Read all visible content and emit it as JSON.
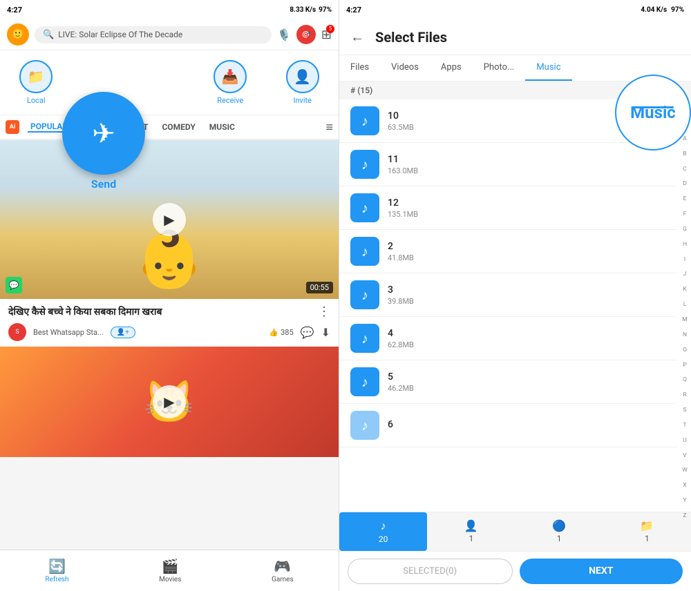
{
  "left": {
    "statusBar": {
      "time": "4:27",
      "speed": "8.33 K/s",
      "battery": "97%"
    },
    "searchBar": {
      "placeholder": "LIVE: Solar Eclipse Of The Decade"
    },
    "actions": [
      {
        "id": "local",
        "label": "Local",
        "icon": "📁"
      },
      {
        "id": "send",
        "label": "Send",
        "icon": "➤"
      },
      {
        "id": "receive",
        "label": "Receive",
        "icon": "📥"
      },
      {
        "id": "invite",
        "label": "Invite",
        "icon": "👤+"
      }
    ],
    "categories": [
      {
        "id": "popular",
        "label": "POPULAR",
        "active": true
      },
      {
        "id": "entertainment",
        "label": "ENTERTAINMENT"
      },
      {
        "id": "comedy",
        "label": "COMEDY"
      },
      {
        "id": "music",
        "label": "MUSIC"
      }
    ],
    "video1": {
      "title": "देखिए कैसे बच्चे ने किया सबका दिमाग खराब",
      "channel": "Best Whatsapp Sta...",
      "likes": "385",
      "duration": "00:55"
    },
    "bottomNav": [
      {
        "id": "refresh",
        "label": "Refresh",
        "icon": "🔄",
        "active": true
      },
      {
        "id": "movies",
        "label": "Movies",
        "icon": "🎬"
      },
      {
        "id": "games",
        "label": "Games",
        "icon": "🎮"
      }
    ]
  },
  "right": {
    "statusBar": {
      "time": "4:27",
      "speed": "4.04 K/s",
      "battery": "97%"
    },
    "header": {
      "title": "Select Files",
      "backIcon": "←"
    },
    "tabs": [
      {
        "id": "files",
        "label": "Files"
      },
      {
        "id": "videos",
        "label": "Videos"
      },
      {
        "id": "apps",
        "label": "Apps"
      },
      {
        "id": "photos",
        "label": "Photo..."
      },
      {
        "id": "music",
        "label": "Music",
        "active": true
      }
    ],
    "sectionHeader": "# (15)",
    "files": [
      {
        "id": "f10",
        "name": "10",
        "size": "63.5MB"
      },
      {
        "id": "f11",
        "name": "11",
        "size": "163.0MB"
      },
      {
        "id": "f12",
        "name": "12",
        "size": "135.1MB"
      },
      {
        "id": "f2",
        "name": "2",
        "size": "41.8MB"
      },
      {
        "id": "f3",
        "name": "3",
        "size": "39.8MB"
      },
      {
        "id": "f4",
        "name": "4",
        "size": "62.8MB"
      },
      {
        "id": "f5",
        "name": "5",
        "size": "46.2MB"
      },
      {
        "id": "f6",
        "name": "6",
        "size": ""
      }
    ],
    "alphaIndex": [
      "#",
      "A",
      "B",
      "C",
      "D",
      "E",
      "F",
      "G",
      "H",
      "I",
      "J",
      "K",
      "L",
      "M",
      "N",
      "O",
      "P",
      "Q",
      "R",
      "S",
      "T",
      "U",
      "V",
      "W",
      "X",
      "Y",
      "Z"
    ],
    "typeTabs": [
      {
        "id": "music20",
        "icon": "♪",
        "count": "20",
        "active": true
      },
      {
        "id": "contacts1",
        "icon": "👤",
        "count": "1"
      },
      {
        "id": "media1",
        "icon": "🔵",
        "count": "1"
      },
      {
        "id": "folder1",
        "icon": "📁",
        "count": "1"
      }
    ],
    "bottomAction": {
      "selectedLabel": "SELECTED(0)",
      "nextLabel": "NEXT"
    },
    "circleAnnotation": {
      "text": "Music"
    }
  }
}
